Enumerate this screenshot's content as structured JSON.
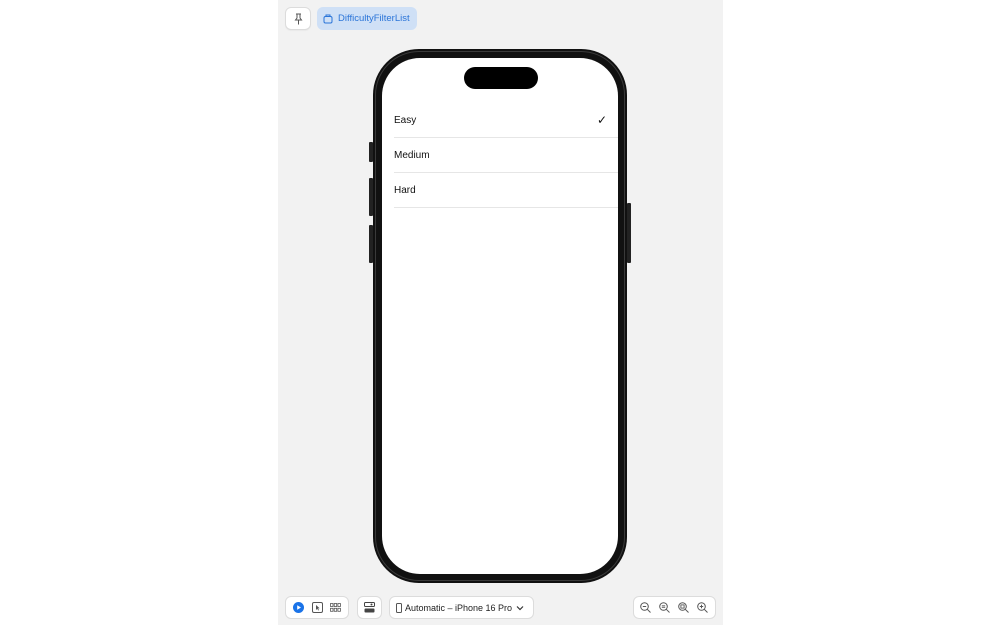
{
  "toolbar_top": {
    "pin_icon": "pin-icon",
    "preview_name": "DifficultyFilterList",
    "preview_icon": "preview-cube-icon"
  },
  "list": {
    "rows": [
      {
        "label": "Easy",
        "selected": true
      },
      {
        "label": "Medium",
        "selected": false
      },
      {
        "label": "Hard",
        "selected": false
      }
    ],
    "checkmark": "✓"
  },
  "toolbar_bottom": {
    "device": "Automatic – iPhone 16 Pro",
    "accent": "#1a73e8"
  }
}
